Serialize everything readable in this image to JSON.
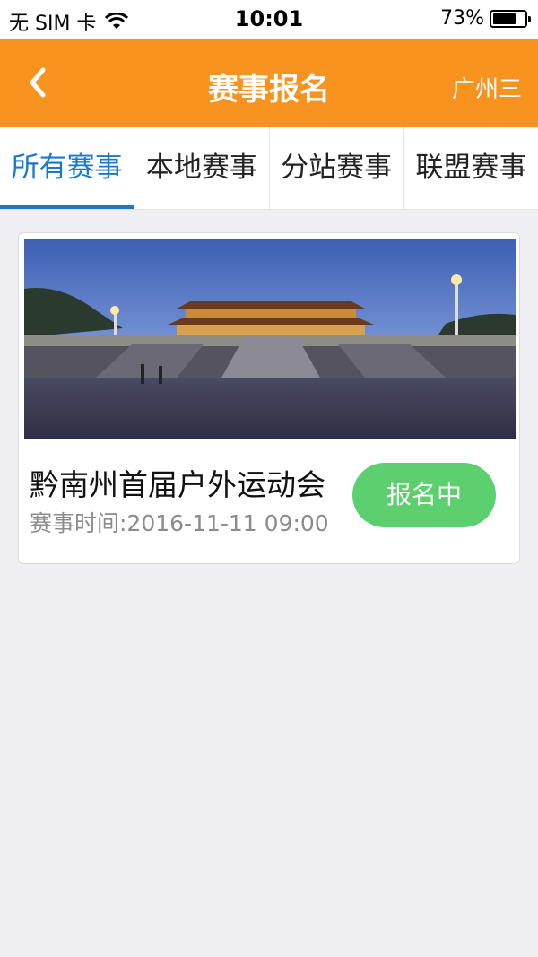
{
  "status_bar": {
    "carrier": "无 SIM 卡",
    "time": "10:01",
    "battery_percent_label": "73%",
    "battery_level": 0.73
  },
  "nav": {
    "title": "赛事报名",
    "city": "广州三",
    "back_icon": "chevron-left-icon"
  },
  "tabs": [
    {
      "label": "所有赛事",
      "active": true
    },
    {
      "label": "本地赛事",
      "active": false
    },
    {
      "label": "分站赛事",
      "active": false
    },
    {
      "label": "联盟赛事",
      "active": false
    }
  ],
  "events": [
    {
      "title": "黔南州首届户外运动会",
      "time": "赛事时间:2016-11-11 09:00",
      "status_label": "报名中"
    }
  ],
  "colors": {
    "nav_orange": "#f7931e",
    "tab_active_blue": "#1a78c9",
    "signup_green": "#5ccf6e",
    "page_bg": "#efeff4"
  }
}
